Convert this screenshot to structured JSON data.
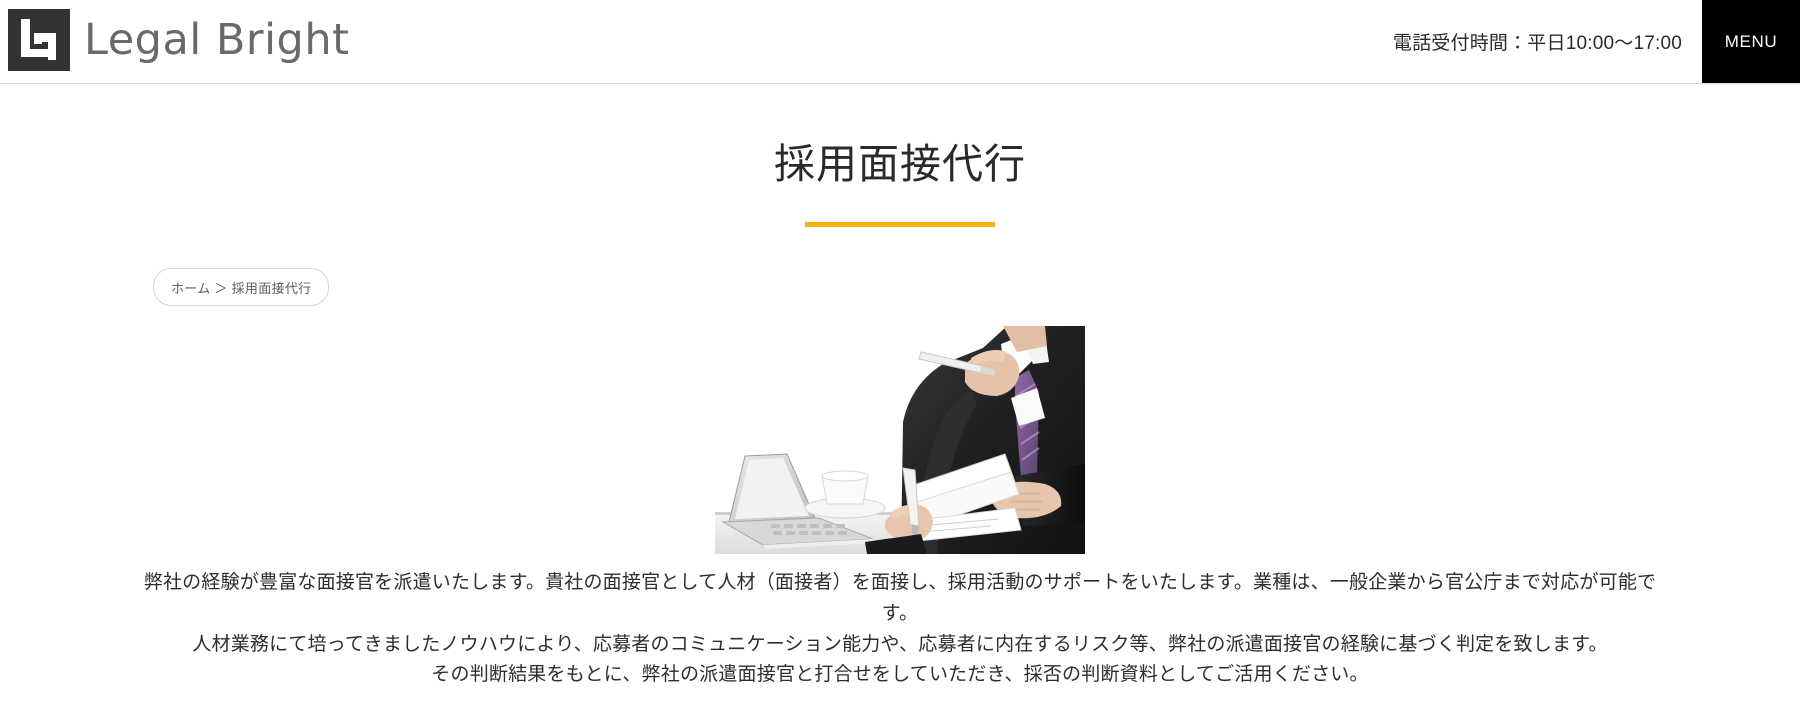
{
  "header": {
    "brand_name": "Legal Bright",
    "brand_mark_name": "legal-bright-logo-mark",
    "hours": "電話受付時間：平日10:00〜17:00",
    "menu_label": "MENU"
  },
  "page": {
    "title": "採用面接代行",
    "accent_color": "#f5b317"
  },
  "breadcrumb": {
    "text": "ホーム ＞ 採用面接代行",
    "home_label": "ホーム",
    "separator": "＞",
    "current_label": "採用面接代行"
  },
  "hero": {
    "alt": "採用面接を行うビジネスマンの写真"
  },
  "content": {
    "paragraphs": [
      "弊社の経験が豊富な面接官を派遣いたします。貴社の面接官として人材（面接者）を面接し、採用活動のサポートをいたします。業種は、一般企業から官公庁まで対応が可能です。",
      "人材業務にて培ってきましたノウハウにより、応募者のコミュニケーション能力や、応募者に内在するリスク等、弊社の派遣面接官の経験に基づく判定を致します。",
      "その判断結果をもとに、弊社の派遣面接官と打合せをしていただき、採否の判断資料としてご活用ください。"
    ]
  }
}
